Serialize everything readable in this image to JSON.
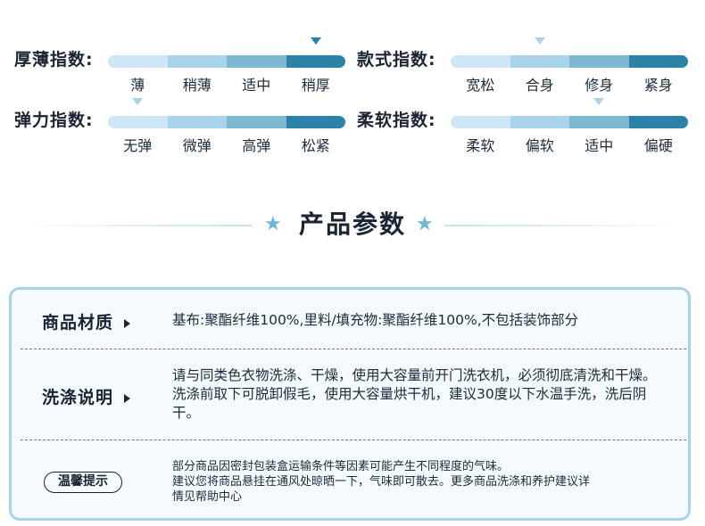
{
  "indices": [
    {
      "title": "厚薄指数:",
      "labels": [
        "薄",
        "稍薄",
        "适中",
        "稍厚"
      ],
      "selected_index": 3
    },
    {
      "title": "款式指数:",
      "labels": [
        "宽松",
        "合身",
        "修身",
        "紧身"
      ],
      "selected_index": 1
    },
    {
      "title": "弹力指数:",
      "labels": [
        "无弹",
        "微弹",
        "高弹",
        "松紧"
      ],
      "selected_index": 0
    },
    {
      "title": "柔软指数:",
      "labels": [
        "柔软",
        "偏软",
        "适中",
        "偏硬"
      ],
      "selected_index": 2
    }
  ],
  "section": {
    "title": "产品参数"
  },
  "params": [
    {
      "label": "商品材质",
      "value": "基布:聚酯纤维100%,里料/填充物:聚酯纤维100%,不包括装饰部分"
    },
    {
      "label": "洗涤说明",
      "value": "请与同类色衣物洗涤、干燥，使用大容量前开门洗衣机，必须彻底清洗和干燥。 洗涤前取下可脱卸假毛，使用大容量烘干机，建议30度以下水温手洗，洗后阴干。"
    }
  ],
  "tip": {
    "label": "温馨提示",
    "lines": [
      "部分商品因密封包装盒运输条件等因素可能产生不同程度的气味。",
      "建议您将商品悬挂在通风处晾晒一下，气味即可散去。更多商品洗涤和养护建议详",
      "情见帮助中心"
    ]
  },
  "colors": {
    "accent": "#2b82a9",
    "light_accent": "#a9d3ea",
    "border": "#a5d3ea",
    "panel_bg": "#f4fafd"
  }
}
